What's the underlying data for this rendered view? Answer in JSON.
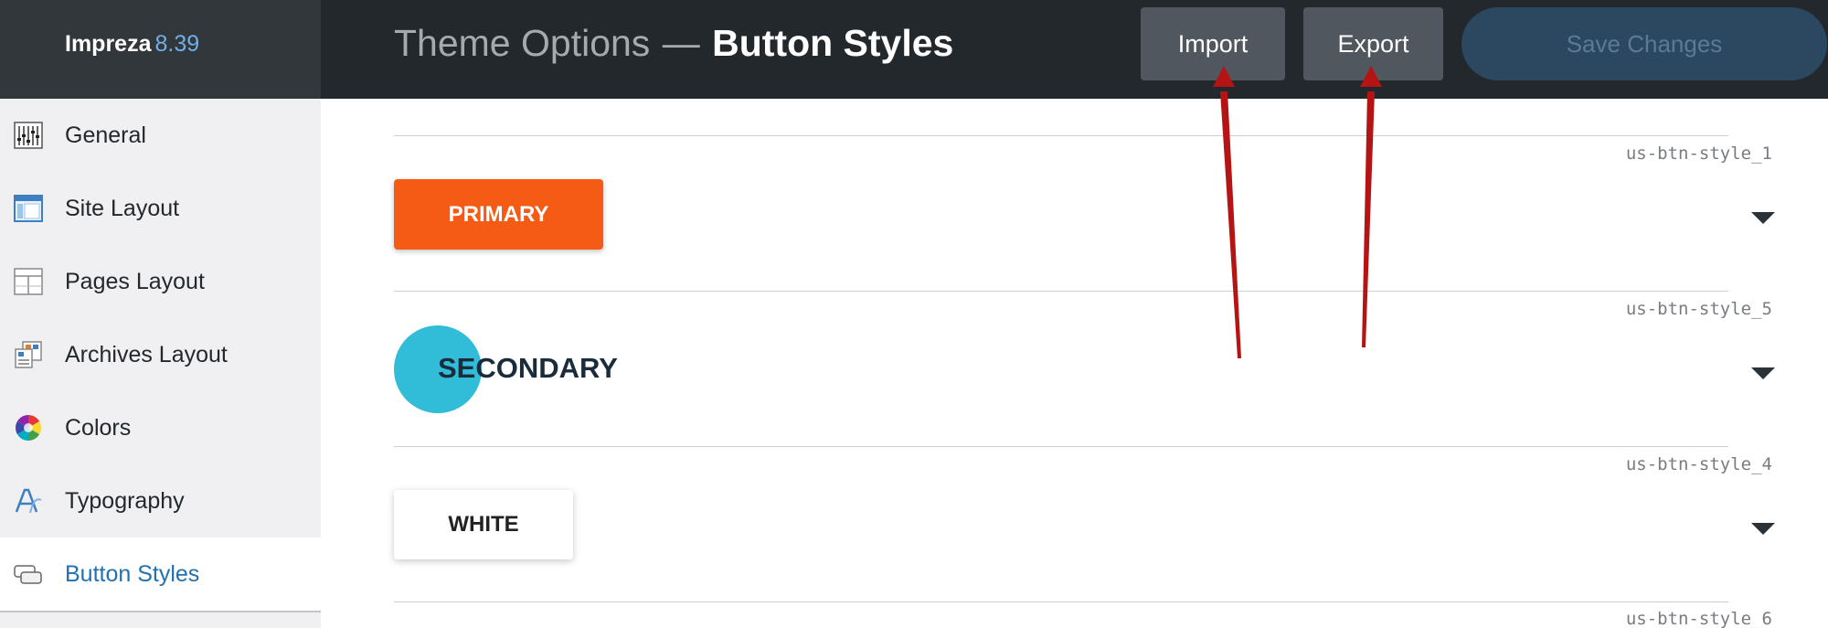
{
  "brand": {
    "name": "Impreza",
    "version": "8.39"
  },
  "header": {
    "title_prefix": "Theme Options",
    "title_separator": "—",
    "title_current": "Button Styles",
    "import_label": "Import",
    "export_label": "Export",
    "save_label": "Save Changes"
  },
  "sidebar": {
    "items": [
      {
        "label": "General",
        "icon": "sliders-icon"
      },
      {
        "label": "Site Layout",
        "icon": "site-layout-icon"
      },
      {
        "label": "Pages Layout",
        "icon": "pages-layout-icon"
      },
      {
        "label": "Archives Layout",
        "icon": "archives-layout-icon"
      },
      {
        "label": "Colors",
        "icon": "color-wheel-icon"
      },
      {
        "label": "Typography",
        "icon": "typography-icon"
      },
      {
        "label": "Button Styles",
        "icon": "button-styles-icon",
        "active": true
      }
    ]
  },
  "button_styles": [
    {
      "id": "us-btn-style_1",
      "preview_label": "PRIMARY",
      "color": "#f55b14"
    },
    {
      "id": "us-btn-style_5",
      "preview_label": "SECONDARY",
      "color": "#31bcd8"
    },
    {
      "id": "us-btn-style_4",
      "preview_label": "WHITE",
      "color": "#ffffff"
    },
    {
      "id": "us-btn-style_6"
    }
  ],
  "colors": {
    "topbar": "#23282d",
    "brand_version": "#72aee6",
    "active_nav": "#2271b1",
    "annotation_arrow": "#b41414"
  }
}
